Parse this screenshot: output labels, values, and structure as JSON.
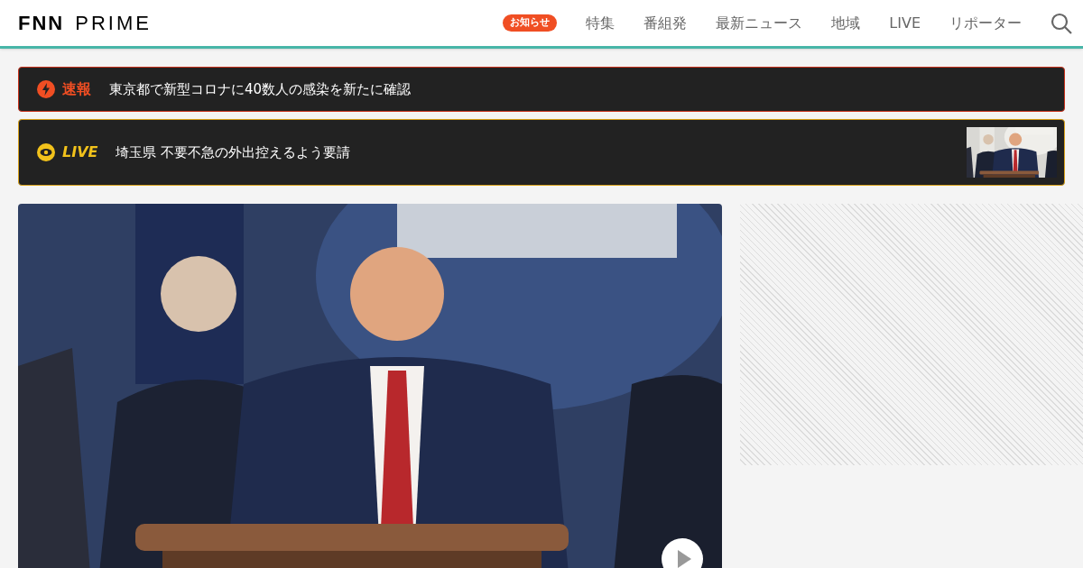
{
  "header": {
    "logo": {
      "mark": "FNN",
      "name": "PRIME"
    },
    "notice_badge": "お知らせ",
    "nav": [
      "特集",
      "番組発",
      "最新ニュース",
      "地域",
      "LIVE",
      "リポーター"
    ]
  },
  "alerts": [
    {
      "kind": "breaking",
      "label": "速報",
      "text": "東京都で新型コロナに40数人の感染を新たに確認"
    },
    {
      "kind": "live",
      "label": "LIVE",
      "text": "埼玉県 不要不急の外出控えるよう要請"
    }
  ]
}
